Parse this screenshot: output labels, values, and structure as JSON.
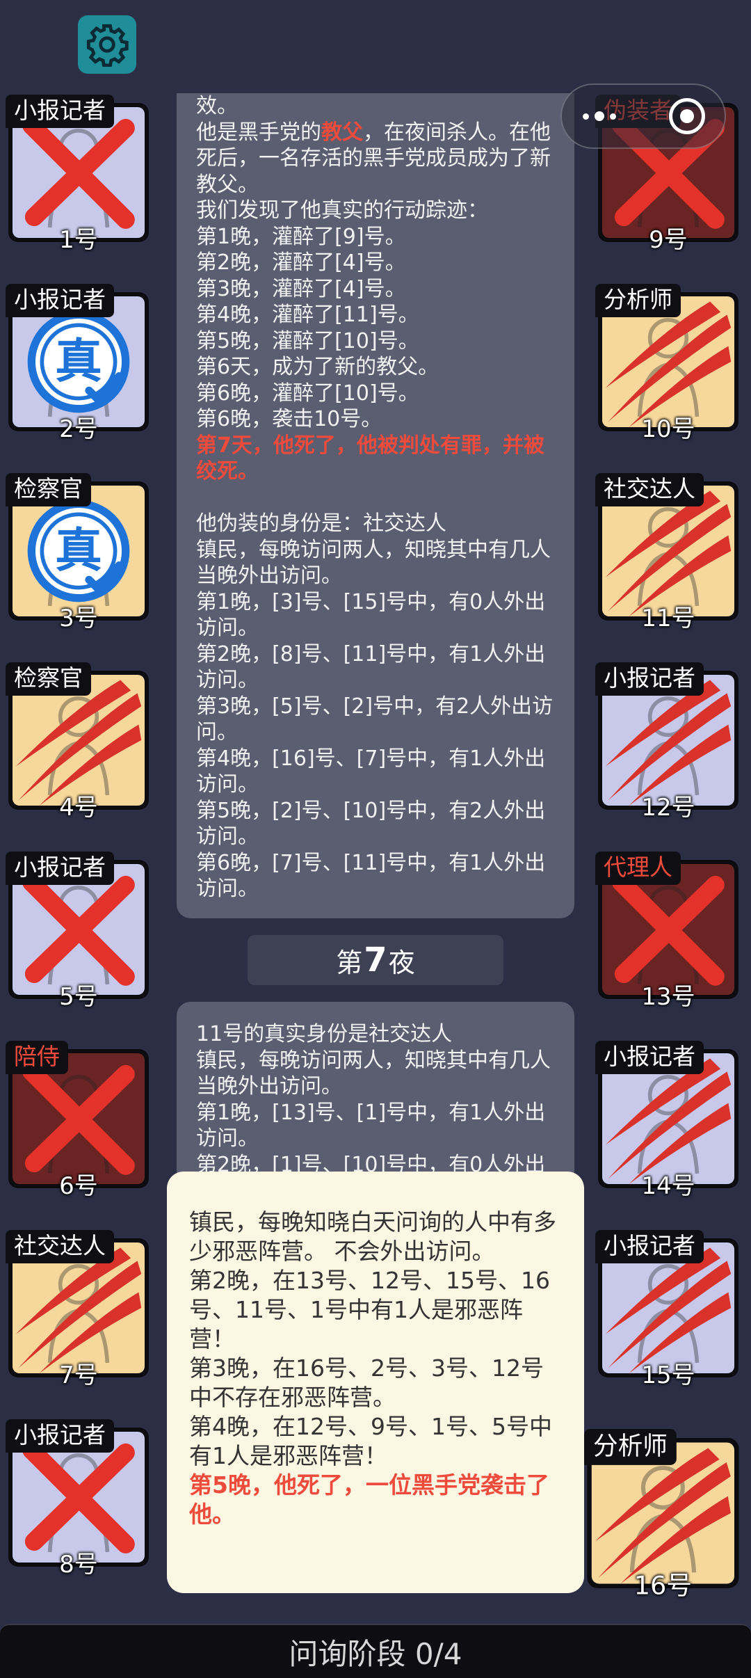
{
  "header": {
    "settings_icon": "gear-icon",
    "capsule_menu_icon": "more-dots-icon",
    "capsule_close_icon": "target-close-icon"
  },
  "players": [
    {
      "num": "1号",
      "role": "小报记者",
      "role_color": "#ffffff",
      "bg": "lav",
      "status": "x"
    },
    {
      "num": "2号",
      "role": "小报记者",
      "role_color": "#ffffff",
      "bg": "lav",
      "status": "true"
    },
    {
      "num": "3号",
      "role": "检察官",
      "role_color": "#ffffff",
      "bg": "peach",
      "status": "true"
    },
    {
      "num": "4号",
      "role": "检察官",
      "role_color": "#ffffff",
      "bg": "peach",
      "status": "claw"
    },
    {
      "num": "5号",
      "role": "小报记者",
      "role_color": "#ffffff",
      "bg": "lav",
      "status": "x"
    },
    {
      "num": "6号",
      "role": "陪侍",
      "role_color": "#ef4b3c",
      "bg": "maroon",
      "status": "x"
    },
    {
      "num": "7号",
      "role": "社交达人",
      "role_color": "#ffffff",
      "bg": "peach",
      "status": "claw"
    },
    {
      "num": "8号",
      "role": "小报记者",
      "role_color": "#ffffff",
      "bg": "lav",
      "status": "x"
    },
    {
      "num": "9号",
      "role": "伪装者",
      "role_color": "#ef4b3c",
      "bg": "maroon",
      "status": "x"
    },
    {
      "num": "10号",
      "role": "分析师",
      "role_color": "#ffffff",
      "bg": "peach",
      "status": "claw"
    },
    {
      "num": "11号",
      "role": "社交达人",
      "role_color": "#ffffff",
      "bg": "peach",
      "status": "claw"
    },
    {
      "num": "12号",
      "role": "小报记者",
      "role_color": "#ffffff",
      "bg": "lav",
      "status": "claw"
    },
    {
      "num": "13号",
      "role": "代理人",
      "role_color": "#ef4b3c",
      "bg": "maroon",
      "status": "x"
    },
    {
      "num": "14号",
      "role": "小报记者",
      "role_color": "#ffffff",
      "bg": "lav",
      "status": "claw"
    },
    {
      "num": "15号",
      "role": "小报记者",
      "role_color": "#ffffff",
      "bg": "lav",
      "status": "claw"
    },
    {
      "num": "16号",
      "role": "分析师",
      "role_color": "#ffffff",
      "bg": "peach",
      "status": "claw"
    }
  ],
  "stamp_text": "真",
  "log1": [
    {
      "t": "效。",
      "hl": false
    },
    {
      "t": "他是黑手党的",
      "hl": false,
      "mid": "教父",
      "after": "，在夜间杀人。在他死后，一名存活的黑手党成员成为了新教父。"
    },
    {
      "t": "我们发现了他真实的行动踪迹：",
      "hl": false
    },
    {
      "t": "第1晚，灌醉了[9]号。",
      "hl": false
    },
    {
      "t": "第2晚，灌醉了[4]号。",
      "hl": false
    },
    {
      "t": "第3晚，灌醉了[4]号。",
      "hl": false
    },
    {
      "t": "第4晚，灌醉了[11]号。",
      "hl": false
    },
    {
      "t": "第5晚，灌醉了[10]号。",
      "hl": false
    },
    {
      "t": "第6天，成为了新的教父。",
      "hl": false
    },
    {
      "t": "第6晚，灌醉了[10]号。",
      "hl": false
    },
    {
      "t": "第6晚，袭击10号。",
      "hl": false
    },
    {
      "t": "第7天，他死了，他被判处有罪，并被绞死。",
      "hl": true
    },
    {
      "t": "",
      "hl": false
    },
    {
      "t": "他伪装的身份是：社交达人",
      "hl": false
    },
    {
      "t": "镇民，每晚访问两人，知晓其中有几人当晚外出访问。",
      "hl": false
    },
    {
      "t": "第1晚，[3]号、[15]号中，有0人外出访问。",
      "hl": false
    },
    {
      "t": "第2晚，[8]号、[11]号中，有1人外出访问。",
      "hl": false
    },
    {
      "t": "第3晚，[5]号、[2]号中，有2人外出访问。",
      "hl": false
    },
    {
      "t": "第4晚，[16]号、[7]号中，有1人外出访问。",
      "hl": false
    },
    {
      "t": "第5晚，[2]号、[10]号中，有2人外出访问。",
      "hl": false
    },
    {
      "t": "第6晚，[7]号、[11]号中，有1人外出访问。",
      "hl": false
    }
  ],
  "night_label": {
    "prefix": "第",
    "num": "7",
    "suffix": "夜"
  },
  "log2": [
    {
      "t": "11号的真实身份是社交达人",
      "hl": false
    },
    {
      "t": "镇民，每晚访问两人，知晓其中有几人当晚外出访问。",
      "hl": false
    },
    {
      "t": "第1晚，[13]号、[1]号中，有1人外出访问。",
      "hl": false
    },
    {
      "t": "第2晚，[1]号、[10]号中，有0人外出访问。",
      "hl": false
    }
  ],
  "tooltip": [
    {
      "t": "镇民，每晚知晓白天问询的人中有多少邪恶阵营。 不会外出访问。",
      "hl": false
    },
    {
      "t": "第2晚，在13号、12号、15号、16号、11号、1号中有1人是邪恶阵营！",
      "hl": false
    },
    {
      "t": "第3晚，在16号、2号、3号、12号中不存在邪恶阵营。",
      "hl": false
    },
    {
      "t": "第4晚，在12号、9号、1号、5号中有1人是邪恶阵营！",
      "hl": false
    },
    {
      "t": "第5晚，他死了，一位黑手党袭击了他。",
      "hl": true
    }
  ],
  "phase_bar": {
    "label": "问询阶段 0/4"
  },
  "colors": {
    "accent_red": "#ef4b3c",
    "stamp_blue": "#1e73d8",
    "bg": "#2b2e45"
  }
}
